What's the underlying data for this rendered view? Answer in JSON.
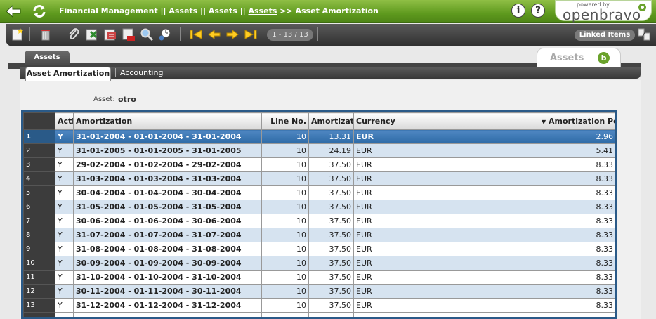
{
  "header": {
    "breadcrumb": {
      "part1": "Financial Management || Assets || Assets ||",
      "link": "Assets",
      "sep": ">>",
      "current": "Asset Amortization"
    },
    "logo_small": "powered by",
    "logo_main": "openbravo",
    "info_label": "i",
    "help_label": "?"
  },
  "toolbar": {
    "record_counter": "1 - 13 / 13",
    "linked_items": "Linked Items"
  },
  "tabs": {
    "parent_tab": "Assets",
    "window_title": "Assets",
    "window_logo": "b",
    "subtabs": [
      "Asset Amortization",
      "Accounting"
    ]
  },
  "form": {
    "asset_label": "Asset:",
    "asset_value": "otro"
  },
  "grid": {
    "columns": [
      "Acti",
      "Amortization",
      "Line No.",
      "Amortizatior",
      "Currency",
      "Amortization Perce"
    ],
    "sort_indicator": "▼",
    "rows": [
      {
        "n": "1",
        "active": "Y",
        "amortization": "31-01-2004 - 01-01-2004 - 31-01-2004",
        "line": "10",
        "amount": "13.31",
        "currency": "EUR",
        "percent": "2.96"
      },
      {
        "n": "2",
        "active": "Y",
        "amortization": "31-01-2005 - 01-01-2005 - 31-01-2005",
        "line": "10",
        "amount": "24.19",
        "currency": "EUR",
        "percent": "5.41"
      },
      {
        "n": "3",
        "active": "Y",
        "amortization": "29-02-2004 - 01-02-2004 - 29-02-2004",
        "line": "10",
        "amount": "37.50",
        "currency": "EUR",
        "percent": "8.33"
      },
      {
        "n": "4",
        "active": "Y",
        "amortization": "31-03-2004 - 01-03-2004 - 31-03-2004",
        "line": "10",
        "amount": "37.50",
        "currency": "EUR",
        "percent": "8.33"
      },
      {
        "n": "5",
        "active": "Y",
        "amortization": "30-04-2004 - 01-04-2004 - 30-04-2004",
        "line": "10",
        "amount": "37.50",
        "currency": "EUR",
        "percent": "8.33"
      },
      {
        "n": "6",
        "active": "Y",
        "amortization": "31-05-2004 - 01-05-2004 - 31-05-2004",
        "line": "10",
        "amount": "37.50",
        "currency": "EUR",
        "percent": "8.33"
      },
      {
        "n": "7",
        "active": "Y",
        "amortization": "30-06-2004 - 01-06-2004 - 30-06-2004",
        "line": "10",
        "amount": "37.50",
        "currency": "EUR",
        "percent": "8.33"
      },
      {
        "n": "8",
        "active": "Y",
        "amortization": "31-07-2004 - 01-07-2004 - 31-07-2004",
        "line": "10",
        "amount": "37.50",
        "currency": "EUR",
        "percent": "8.33"
      },
      {
        "n": "9",
        "active": "Y",
        "amortization": "31-08-2004 - 01-08-2004 - 31-08-2004",
        "line": "10",
        "amount": "37.50",
        "currency": "EUR",
        "percent": "8.33"
      },
      {
        "n": "10",
        "active": "Y",
        "amortization": "30-09-2004 - 01-09-2004 - 30-09-2004",
        "line": "10",
        "amount": "37.50",
        "currency": "EUR",
        "percent": "8.33"
      },
      {
        "n": "11",
        "active": "Y",
        "amortization": "31-10-2004 - 01-10-2004 - 31-10-2004",
        "line": "10",
        "amount": "37.50",
        "currency": "EUR",
        "percent": "8.33"
      },
      {
        "n": "12",
        "active": "Y",
        "amortization": "30-11-2004 - 01-11-2004 - 30-11-2004",
        "line": "10",
        "amount": "37.50",
        "currency": "EUR",
        "percent": "8.33"
      },
      {
        "n": "13",
        "active": "Y",
        "amortization": "31-12-2004 - 01-12-2004 - 31-12-2004",
        "line": "10",
        "amount": "37.50",
        "currency": "EUR",
        "percent": "8.33"
      }
    ]
  },
  "colors": {
    "nav_green": "#5f9a1e",
    "selected_row": "#3a78b5",
    "alt_row": "#d6e3f0",
    "grid_border": "#2a5a88"
  },
  "icons": {
    "back": "back-arrow-icon",
    "refresh": "refresh-icon",
    "new": "new-record-icon",
    "delete": "delete-icon",
    "attach": "attachment-icon",
    "excel": "export-excel-icon",
    "csv": "export-csv-icon",
    "pdf": "export-pdf-icon",
    "search": "search-icon",
    "audit": "audit-trail-icon",
    "first": "first-record-icon",
    "prev": "previous-record-icon",
    "next": "next-record-icon",
    "last": "last-record-icon",
    "linked": "linked-items-icon"
  }
}
